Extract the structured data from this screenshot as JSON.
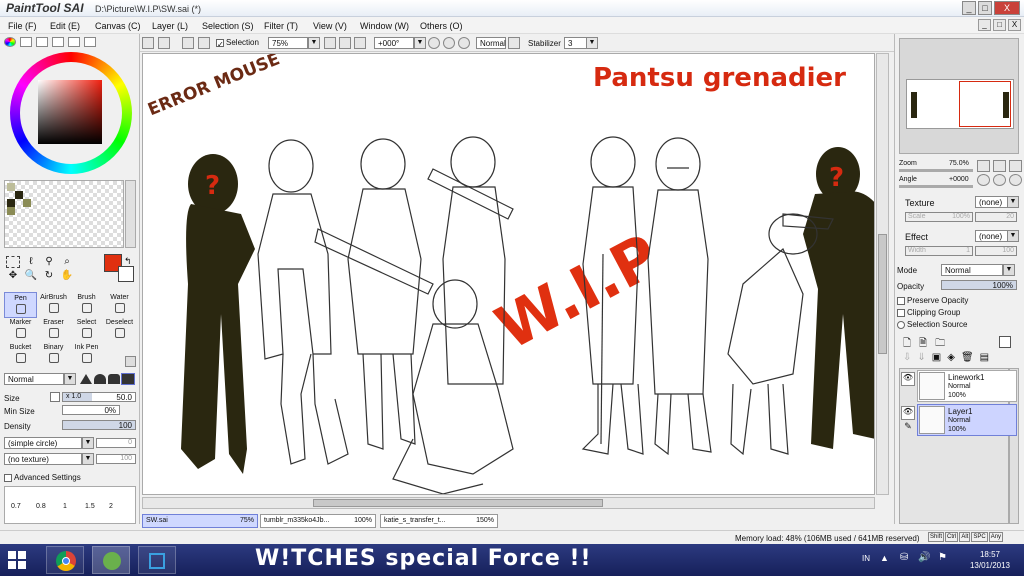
{
  "window": {
    "app_logo": "PaintTool SAI",
    "title": "D:\\Picture\\W.I.P\\SW.sai (*)",
    "controls": {
      "minimize": "_",
      "maximize": "□",
      "close": "X"
    }
  },
  "menu": {
    "items": [
      "File (F)",
      "Edit (E)",
      "Canvas (C)",
      "Layer (L)",
      "Selection (S)",
      "Filter (T)",
      "View (V)",
      "Window (W)",
      "Others (O)"
    ]
  },
  "toolbar": {
    "selection_label": "Selection",
    "zoom": "75%",
    "rotation": "+000°",
    "blend_mode": "Normal",
    "stabilizer_label": "Stabilizer",
    "stabilizer_value": "3"
  },
  "tools": {
    "row1": [
      "Pen",
      "AirBrush",
      "Brush",
      "Water"
    ],
    "row2": [
      "Marker",
      "Eraser",
      "Select",
      "Deselect"
    ],
    "row3": [
      "Bucket",
      "Binary",
      "Ink Pen"
    ]
  },
  "brush": {
    "mode": "Normal",
    "size_label": "Size",
    "size_mult": "x 1.0",
    "size_value": "50.0",
    "min_size_label": "Min Size",
    "min_size_value": "0%",
    "density_label": "Density",
    "density_value": "100",
    "shape": "(simple circle)",
    "shape_value": "0",
    "texture": "(no texture)",
    "texture_value": "100",
    "advanced": "Advanced Settings",
    "size_presets": [
      "0.7",
      "0.8",
      "1",
      "1.5",
      "2"
    ]
  },
  "canvas_text": {
    "error_mouse": "ERROR MOUSE",
    "heading": "Pantsu grenadier",
    "wip": "W.I.P",
    "question": "?"
  },
  "navigator": {
    "zoom_label": "Zoom",
    "zoom_value": "75.0%",
    "angle_label": "Angle",
    "angle_value": "+0000"
  },
  "layer_props": {
    "texture_label": "Texture",
    "texture_value": "(none)",
    "scale_label": "Scale",
    "scale_value": "100%",
    "scale_num": "20",
    "effect_label": "Effect",
    "effect_value": "(none)",
    "width_label": "Width",
    "width_value": "1",
    "width_num": "100",
    "mode_label": "Mode",
    "mode_value": "Normal",
    "opacity_label": "Opacity",
    "opacity_value": "100%",
    "opacity_fraction": 1.0,
    "preserve_opacity": "Preserve Opacity",
    "clipping_group": "Clipping Group",
    "selection_source": "Selection Source"
  },
  "layers": [
    {
      "name": "Linework1",
      "mode": "Normal",
      "opacity": "100%",
      "selected": false
    },
    {
      "name": "Layer1",
      "mode": "Normal",
      "opacity": "100%",
      "selected": true
    }
  ],
  "documents": [
    {
      "name": "SW.sai",
      "zoom": "75%"
    },
    {
      "name": "tumblr_m335ko4Jb...",
      "zoom": "100%"
    },
    {
      "name": "katie_s_transfer_t...",
      "zoom": "150%"
    }
  ],
  "status": {
    "memory": "Memory load: 48% (106MB used / 641MB reserved)",
    "keys": [
      "Shift",
      "Ctrl",
      "Alt",
      "SPC",
      "Any"
    ]
  },
  "taskbar": {
    "caption": "W!TCHES special Force !!",
    "lang": "IN",
    "time": "18:57",
    "date": "13/01/2013"
  },
  "colors": {
    "fg": "#e03010",
    "bg": "#ffffff",
    "accent": "#cfd8ff",
    "silhouette": "#2a2710",
    "annotation_red": "#d62a10",
    "annotation_dark": "#6b2a14"
  }
}
